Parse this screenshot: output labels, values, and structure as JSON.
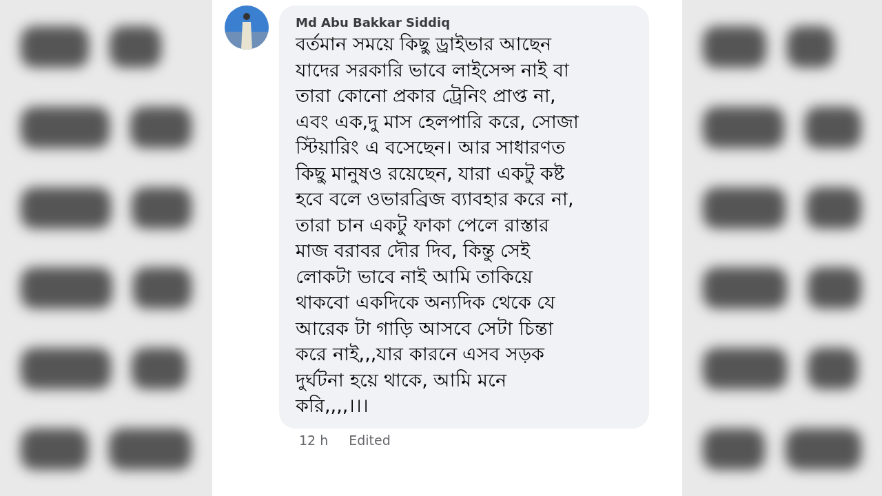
{
  "comment": {
    "author": "Md Abu Bakkar Siddiq",
    "text": "বর্তমান সময়ে কিছু ড্রাইভার আছেন\nযাদের সরকারি ভাবে লাইসেন্স নাই বা\nতারা কোনো প্রকার ট্রেনিং প্রাপ্ত না,\nএবং এক,দু মাস হেলপারি করে, সোজা\nস্টিয়ারিং এ বসেছেন। আর সাধারণত\nকিছু মানুষও রয়েছেন, যারা একটু কষ্ট\nহবে বলে ওভারব্রিজ ব্যাবহার করে না,\nতারা চান একটু ফাকা পেলে রাস্তার\nমাজ বরাবর দৌর দিব, কিন্তু সেই\nলোকটা ভাবে নাই আমি তাকিয়ে\nথাকবো একদিকে অন্যদিক থেকে যে\nআরেক টা গাড়ি আসবে সেটা চিন্তা\nকরে নাই,,,যার কারনে এসব সড়ক\nদুর্ঘটনা হয়ে থাকে, আমি মনে\nকরি,,,,।।।",
    "time": "12 h",
    "edited": "Edited"
  }
}
